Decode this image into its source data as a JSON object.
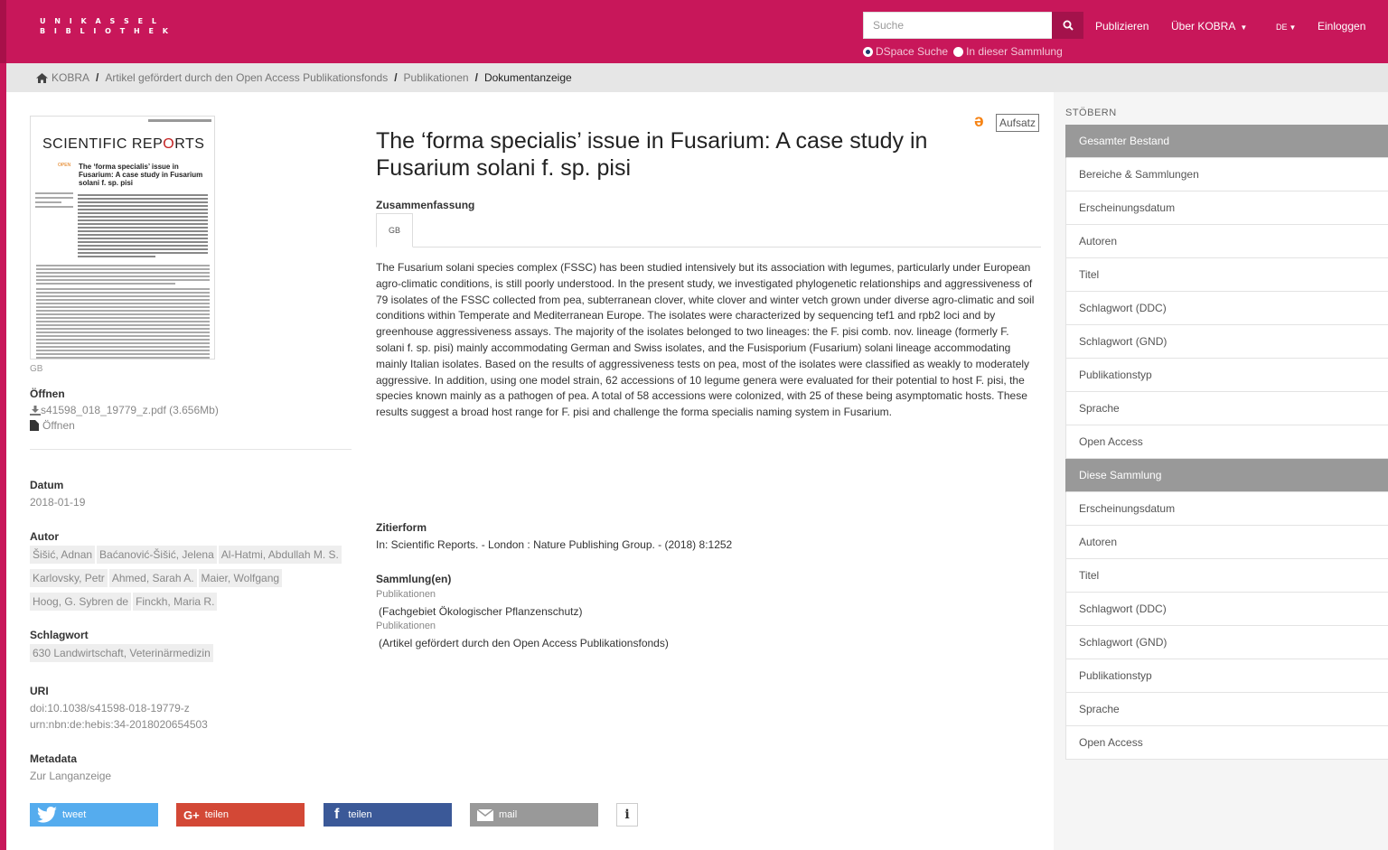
{
  "header": {
    "logo_line1": "U N I K A S S E L",
    "logo_line2": "B I B L I O T H E K",
    "search_placeholder": "Suche",
    "scope_options": [
      "DSpace Suche",
      "In dieser Sammlung"
    ],
    "nav_publish": "Publizieren",
    "nav_about": "Über KOBRA",
    "nav_lang": "DE",
    "nav_login": "Einloggen"
  },
  "breadcrumb": {
    "items": [
      "KOBRA",
      "Artikel gefördert durch den Open Access Publikationsfonds",
      "Publikationen"
    ],
    "current": "Dokumentanzeige"
  },
  "thumbnail": {
    "brand": "SCIENTIFIC REPORTS",
    "open_label": "OPEN",
    "title": "The ‘forma specialis’ issue in Fusarium: A case study in Fusarium solani f. sp. pisi",
    "caption": "GB"
  },
  "left": {
    "open_heading": "Öffnen",
    "file_link": "s41598_018_19779_z.pdf (3.656Mb)",
    "open_link": "Öffnen",
    "date_heading": "Datum",
    "date_value": "2018-01-19",
    "author_heading": "Autor",
    "authors": [
      "Šišić, Adnan",
      "Baćanović-Šišić, Jelena",
      "Al-Hatmi, Abdullah M. S.",
      "Karlovsky, Petr",
      "Ahmed, Sarah A.",
      "Maier, Wolfgang",
      "Hoog, G. Sybren de",
      "Finckh, Maria R."
    ],
    "keyword_heading": "Schlagwort",
    "keyword": "630  Landwirtschaft, Veterinärmedizin",
    "uri_heading": "URI",
    "uri_doi": "doi:10.1038/s41598-018-19779-z",
    "uri_urn": "urn:nbn:de:hebis:34-2018020654503",
    "metadata_heading": "Metadata",
    "metadata_link": "Zur Langanzeige"
  },
  "main": {
    "title": "The ‘forma specialis’ issue in Fusarium: A case study in Fusarium solani f. sp. pisi",
    "type_badge": "Aufsatz",
    "summary_heading": "Zusammenfassung",
    "tab_label": "GB",
    "abstract": "The Fusarium solani species complex (FSSC) has been studied intensively but its association with legumes, particularly under European agro-climatic conditions, is still poorly understood. In the present study, we investigated phylogenetic relationships and aggressiveness of 79 isolates of the FSSC collected from pea, subterranean clover, white clover and winter vetch grown under diverse agro-climatic and soil conditions within Temperate and Mediterranean Europe. The isolates were characterized by sequencing tef1 and rpb2 loci and by greenhouse aggressiveness assays. The majority of the isolates belonged to two lineages: the F. pisi comb. nov. lineage (formerly F. solani f. sp. pisi) mainly accommodating German and Swiss isolates, and the Fusisporium (Fusarium) solani lineage accommodating mainly Italian isolates. Based on the results of aggressiveness tests on pea, most of the isolates were classified as weakly to moderately aggressive. In addition, using one model strain, 62 accessions of 10 legume genera were evaluated for their potential to host F. pisi, the species known mainly as a pathogen of pea. A total of 58 accessions were colonized, with 25 of these being asymptomatic hosts. These results suggest a broad host range for F. pisi and challenge the forma specialis naming system in Fusarium.",
    "citation_heading": "Zitierform",
    "citation": "In: Scientific Reports. - London : Nature Publishing Group. - (2018) 8:1252",
    "collections_heading": "Sammlung(en)",
    "collection1_link": "Publikationen",
    "collection1_detail": "(Fachgebiet Ökologischer Pflanzenschutz)",
    "collection2_link": "Publikationen",
    "collection2_detail": "(Artikel gefördert durch den Open Access Publikationsfonds)"
  },
  "sidebar": {
    "heading": "STÖBERN",
    "group1": "Gesamter Bestand",
    "group1_items": [
      "Bereiche & Sammlungen",
      "Erscheinungsdatum",
      "Autoren",
      "Titel",
      "Schlagwort (DDC)",
      "Schlagwort (GND)",
      "Publikationstyp",
      "Sprache",
      "Open Access"
    ],
    "group2": "Diese Sammlung",
    "group2_items": [
      "Erscheinungsdatum",
      "Autoren",
      "Titel",
      "Schlagwort (DDC)",
      "Schlagwort (GND)",
      "Publikationstyp",
      "Sprache",
      "Open Access"
    ]
  },
  "share": {
    "tweet": "tweet",
    "gplus": "teilen",
    "facebook": "teilen",
    "mail": "mail"
  },
  "colors": {
    "brand": "#c8175a",
    "twitter": "#55acee",
    "gplus": "#d34836",
    "facebook": "#3b5998",
    "mail": "#999999",
    "oa": "#f68212"
  }
}
